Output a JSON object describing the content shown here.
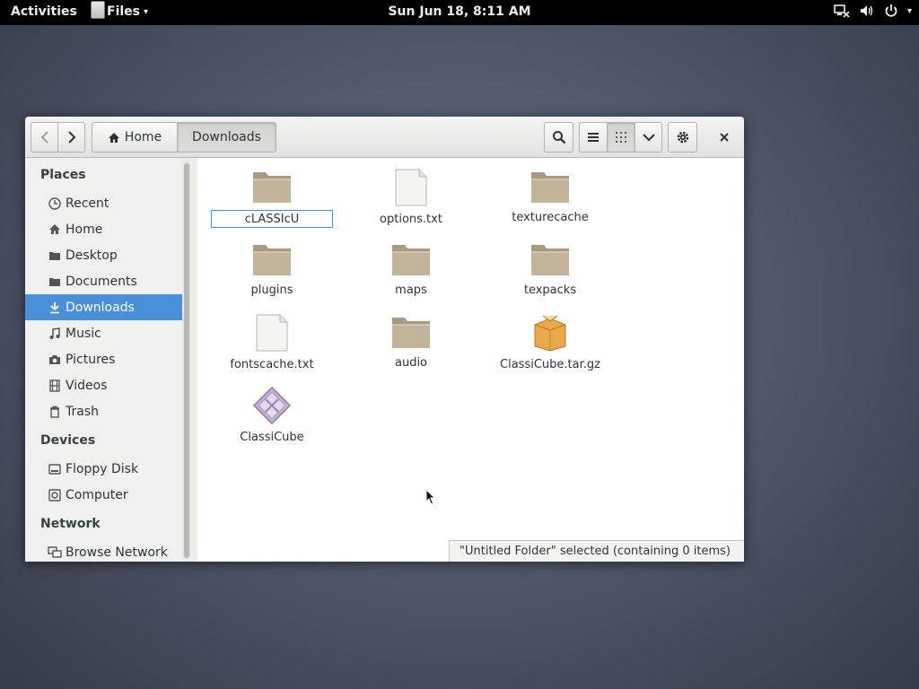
{
  "topbar": {
    "activities": "Activities",
    "app_name": "Files",
    "clock": "Sun Jun 18,  8:11 AM"
  },
  "toolbar": {
    "crumbs": [
      "Home",
      "Downloads"
    ]
  },
  "sidebar": {
    "places_heading": "Places",
    "places": [
      {
        "label": "Recent",
        "icon": "clock-icon"
      },
      {
        "label": "Home",
        "icon": "home-icon"
      },
      {
        "label": "Desktop",
        "icon": "folder-icon"
      },
      {
        "label": "Documents",
        "icon": "folder-icon"
      },
      {
        "label": "Downloads",
        "icon": "download-icon",
        "selected": true
      },
      {
        "label": "Music",
        "icon": "music-icon"
      },
      {
        "label": "Pictures",
        "icon": "camera-icon"
      },
      {
        "label": "Videos",
        "icon": "film-icon"
      },
      {
        "label": "Trash",
        "icon": "trash-icon"
      }
    ],
    "devices_heading": "Devices",
    "devices": [
      {
        "label": "Floppy Disk",
        "icon": "drive-icon"
      },
      {
        "label": "Computer",
        "icon": "drive-icon"
      }
    ],
    "network_heading": "Network",
    "network": [
      {
        "label": "Browse Network",
        "icon": "network-icon"
      }
    ]
  },
  "files": [
    {
      "name": "cLASSIcU",
      "type": "folder",
      "renaming": true
    },
    {
      "name": "options.txt",
      "type": "text"
    },
    {
      "name": "texturecache",
      "type": "folder"
    },
    {
      "name": "plugins",
      "type": "folder"
    },
    {
      "name": "maps",
      "type": "folder"
    },
    {
      "name": "texpacks",
      "type": "folder"
    },
    {
      "name": "fontscache.txt",
      "type": "text"
    },
    {
      "name": "audio",
      "type": "folder"
    },
    {
      "name": "ClassiCube.tar.gz",
      "type": "archive"
    },
    {
      "name": "ClassiCube",
      "type": "executable"
    }
  ],
  "status": "\"Untitled Folder\" selected  (containing 0 items)",
  "colors": {
    "selection": "#4a90d9",
    "folder": "#c1b49a"
  }
}
